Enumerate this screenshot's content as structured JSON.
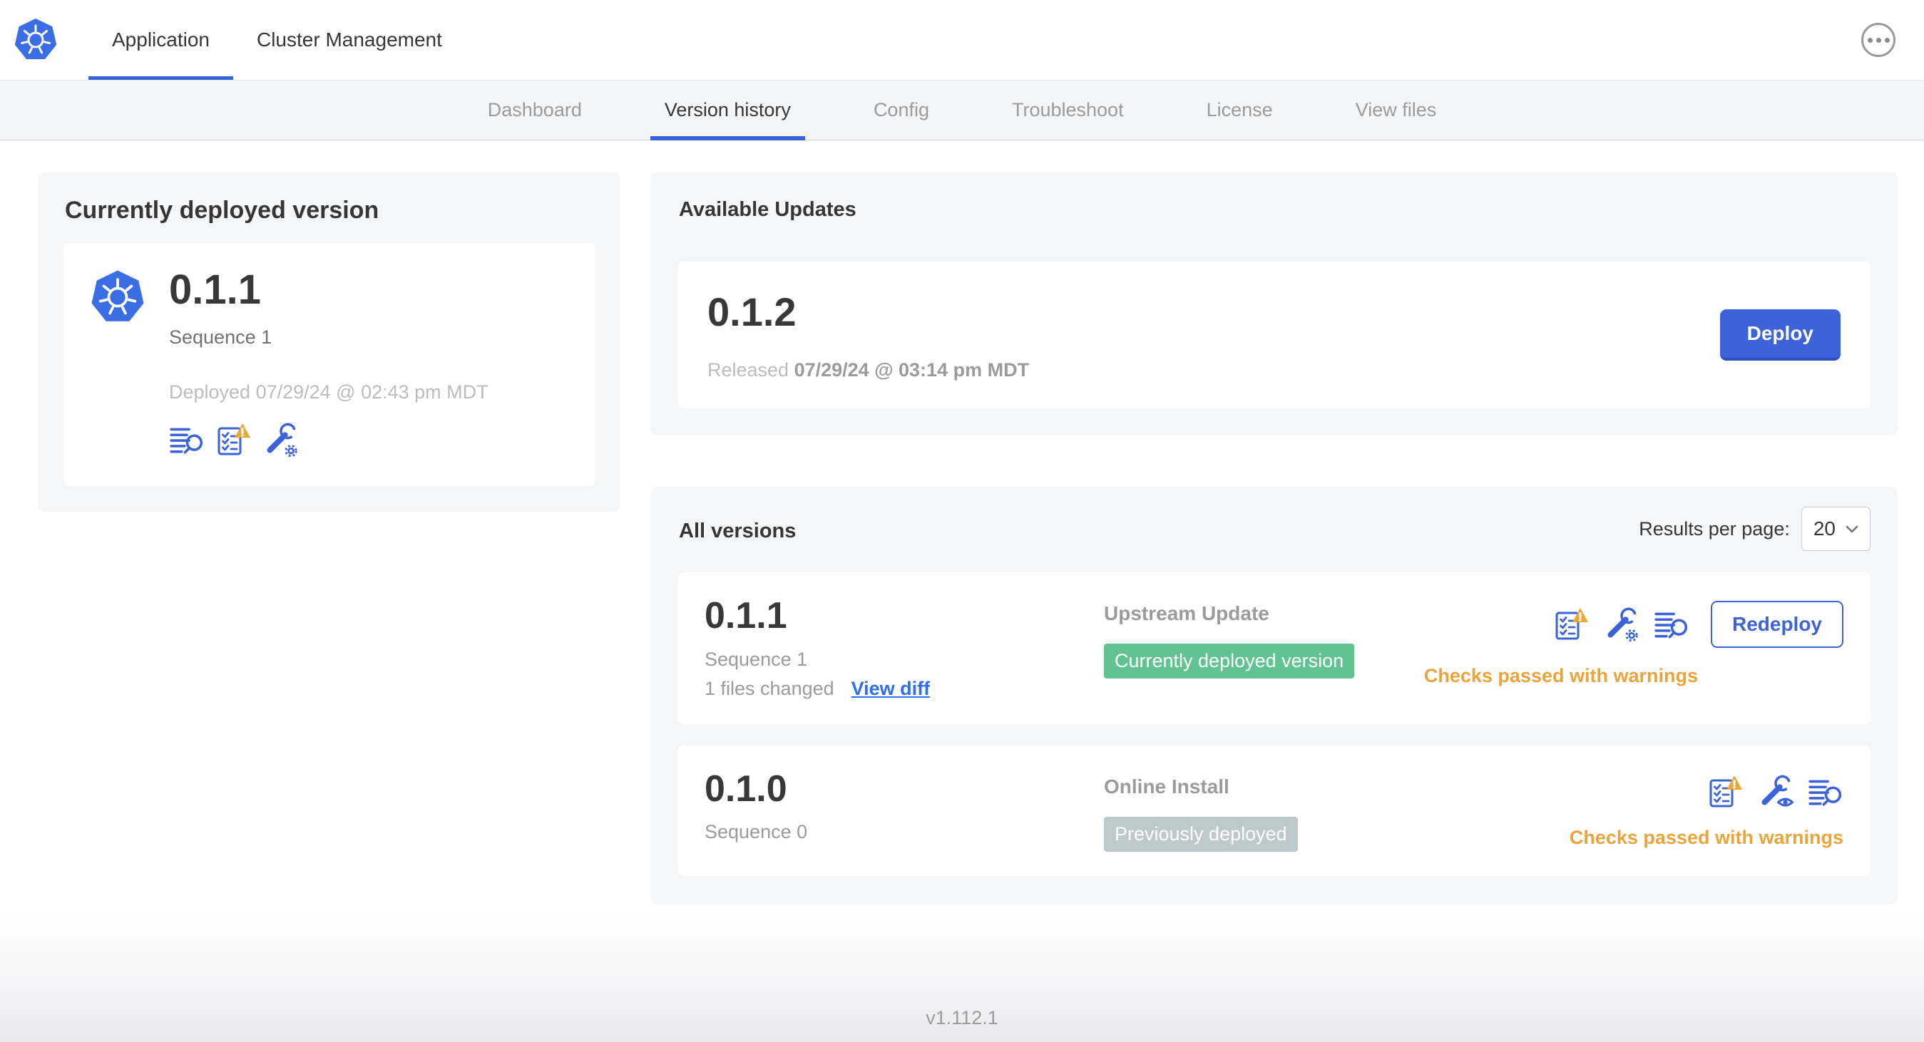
{
  "header": {
    "logo_icon": "kubernetes-logo",
    "tabs": [
      {
        "label": "Application",
        "active": true
      },
      {
        "label": "Cluster Management",
        "active": false
      }
    ],
    "overflow_menu_icon": "ellipsis-icon"
  },
  "subnav": {
    "tabs": [
      {
        "label": "Dashboard",
        "active": false
      },
      {
        "label": "Version history",
        "active": true
      },
      {
        "label": "Config",
        "active": false
      },
      {
        "label": "Troubleshoot",
        "active": false
      },
      {
        "label": "License",
        "active": false
      },
      {
        "label": "View files",
        "active": false
      }
    ]
  },
  "current_version": {
    "title": "Currently deployed version",
    "app_icon": "kubernetes-logo",
    "version": "0.1.1",
    "sequence": "Sequence 1",
    "deployed": "Deployed 07/29/24 @ 02:43 pm MDT",
    "icons": [
      "view-logs",
      "preflight-checks-warning",
      "edit-config"
    ]
  },
  "available_updates": {
    "title": "Available Updates",
    "version": "0.1.2",
    "released_prefix": "Released",
    "released_date": "07/29/24 @ 03:14 pm MDT",
    "deploy_label": "Deploy"
  },
  "all_versions": {
    "title": "All versions",
    "results_per_page_label": "Results per page:",
    "results_per_page_value": "20",
    "rows": [
      {
        "version": "0.1.1",
        "sequence": "Sequence 1",
        "files_changed": "1 files changed",
        "view_diff_label": "View diff",
        "source": "Upstream Update",
        "badge": {
          "label": "Currently deployed version",
          "color": "#61c392"
        },
        "icons": [
          "preflight-checks-warning",
          "edit-config",
          "view-logs"
        ],
        "action_label": "Redeploy",
        "checks": "Checks passed with warnings"
      },
      {
        "version": "0.1.0",
        "sequence": "Sequence 0",
        "source": "Online Install",
        "badge": {
          "label": "Previously deployed",
          "color": "#bec9cb"
        },
        "icons": [
          "preflight-checks-warning",
          "view-config",
          "view-logs"
        ],
        "checks": "Checks passed with warnings"
      }
    ]
  },
  "footer": {
    "version": "v1.112.1"
  },
  "colors": {
    "accent_blue": "#3b63d9",
    "link_blue": "#2f6ef2",
    "warning_amber": "#e9a43c",
    "badge_green": "#61c392",
    "badge_gray": "#bec9cb",
    "subnav_bg": "#f4f5f7",
    "card_bg": "#f5f6f8"
  }
}
